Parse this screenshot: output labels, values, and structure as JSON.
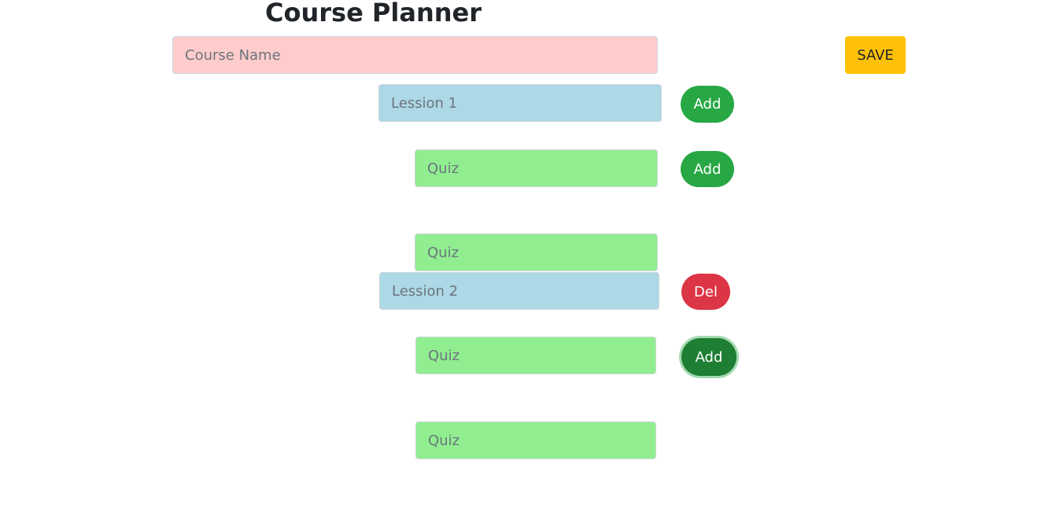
{
  "page": {
    "title": "Course Planner"
  },
  "colors": {
    "course_bg": "#ffcccc",
    "lesson_bg": "#add8e6",
    "quiz_bg": "#90ee90",
    "add_button": "#28a745",
    "add_button_active": "#1e7e34",
    "delete_button": "#dc3545",
    "save_button": "#ffc107"
  },
  "course": {
    "name_placeholder": "Course Name",
    "name_value": "",
    "save_label": "SAVE"
  },
  "lessons": [
    {
      "placeholder": "Lession 1",
      "action_label": "Add",
      "quizzes": [
        {
          "placeholder": "Quiz",
          "action_label": "Add"
        },
        {
          "placeholder": "Quiz"
        }
      ]
    },
    {
      "placeholder": "Lession 2",
      "action_label": "Del",
      "quizzes": [
        {
          "placeholder": "Quiz",
          "action_label": "Add"
        },
        {
          "placeholder": "Quiz"
        }
      ]
    }
  ]
}
